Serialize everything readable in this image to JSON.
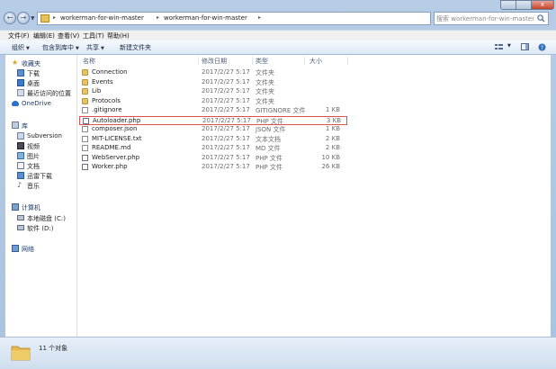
{
  "window": {
    "back_label": "←",
    "forward_label": "→",
    "close_label": "x"
  },
  "address": {
    "crumbs": [
      "workerman-for-win-master",
      "workerman-for-win-master"
    ],
    "separator": "▸"
  },
  "search": {
    "placeholder": "搜索 workerman-for-win-master"
  },
  "menu": [
    "文件(F)",
    "编辑(E)",
    "查看(V)",
    "工具(T)",
    "帮助(H)"
  ],
  "toolbar": {
    "organize": "组织",
    "include_in_library": "包含到库中",
    "share": "共享",
    "new_folder": "新建文件夹"
  },
  "nav": {
    "favorites": {
      "label": "收藏夹",
      "items": [
        "下载",
        "桌面",
        "最近访问的位置"
      ]
    },
    "onedrive": "OneDrive",
    "libraries": {
      "label": "库",
      "items": [
        "Subversion",
        "视频",
        "图片",
        "文档",
        "迅雷下载",
        "音乐"
      ]
    },
    "computer": {
      "label": "计算机",
      "items": [
        "本地磁盘 (C:)",
        "软件 (D:)"
      ]
    },
    "network": "网络"
  },
  "columns": {
    "name": "名称",
    "date": "修改日期",
    "type": "类型",
    "size": "大小"
  },
  "files": [
    {
      "name": "Connection",
      "date": "2017/2/27 5:17",
      "type": "文件夹",
      "size": "",
      "kind": "folder"
    },
    {
      "name": "Events",
      "date": "2017/2/27 5:17",
      "type": "文件夹",
      "size": "",
      "kind": "folder"
    },
    {
      "name": "Lib",
      "date": "2017/2/27 5:17",
      "type": "文件夹",
      "size": "",
      "kind": "folder"
    },
    {
      "name": "Protocols",
      "date": "2017/2/27 5:17",
      "type": "文件夹",
      "size": "",
      "kind": "folder"
    },
    {
      "name": ".gitignore",
      "date": "2017/2/27 5:17",
      "type": "GITIGNORE 文件",
      "size": "1 KB",
      "kind": "file"
    },
    {
      "name": "Autoloader.php",
      "date": "2017/2/27 5:17",
      "type": "PHP 文件",
      "size": "3 KB",
      "kind": "php",
      "highlighted": true
    },
    {
      "name": "composer.json",
      "date": "2017/2/27 5:17",
      "type": "JSON 文件",
      "size": "1 KB",
      "kind": "file"
    },
    {
      "name": "MIT-LICENSE.txt",
      "date": "2017/2/27 5:17",
      "type": "文本文档",
      "size": "2 KB",
      "kind": "file"
    },
    {
      "name": "README.md",
      "date": "2017/2/27 5:17",
      "type": "MD 文件",
      "size": "2 KB",
      "kind": "file"
    },
    {
      "name": "WebServer.php",
      "date": "2017/2/27 5:17",
      "type": "PHP 文件",
      "size": "10 KB",
      "kind": "php"
    },
    {
      "name": "Worker.php",
      "date": "2017/2/27 5:17",
      "type": "PHP 文件",
      "size": "26 KB",
      "kind": "php"
    }
  ],
  "status": {
    "count": "11 个对象"
  },
  "colors": {
    "highlight_border": "#e0504a",
    "folder": "#e9c35c",
    "nav_header": "#1e3a66"
  }
}
